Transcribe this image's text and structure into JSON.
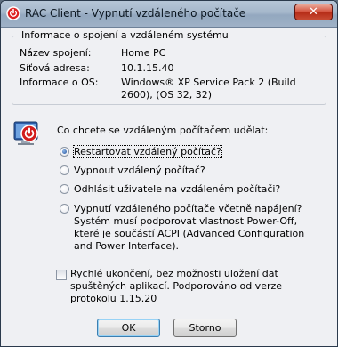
{
  "window": {
    "title": "RAC Client - Vypnutí vzdáleného počítače",
    "close_label": "✕"
  },
  "info_group": {
    "legend": "Informace o spojení a vzdáleném systému",
    "rows": [
      {
        "label": "Název spojení:",
        "value": "Home PC"
      },
      {
        "label": "Síťová adresa:",
        "value": "10.1.15.40"
      },
      {
        "label": "Informace o OS:",
        "value": "Windows® XP Service Pack 2 (Build 2600), (OS 32, 32)"
      }
    ]
  },
  "prompt": "Co chcete se vzdáleným počítačem udělat:",
  "options": [
    {
      "label": "Restartovat vzdálený počítač?",
      "checked": true
    },
    {
      "label": "Vypnout vzdálený počítač?",
      "checked": false
    },
    {
      "label": "Odhlásit uživatele na vzdáleném počítači?",
      "checked": false
    },
    {
      "label": "Vypnutí vzdáleného počítače včetně napájení? Systém musí podporovat vlastnost Power-Off, které je součástí ACPI (Advanced Configuration and Power Interface).",
      "checked": false
    }
  ],
  "quick_shutdown": {
    "label": "Rychlé ukončení, bez možnosti uložení dat spuštěných aplikací. Podporováno od verze  protokolu 1.15.20",
    "checked": false
  },
  "buttons": {
    "ok": "OK",
    "cancel": "Storno"
  },
  "icons": {
    "app": "rac-power-icon",
    "prompt": "monitor-power-icon"
  }
}
